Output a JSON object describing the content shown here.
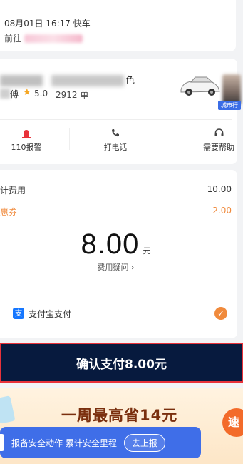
{
  "trip": {
    "time_text": "08月01日 16:17 快车",
    "dest_prefix": "前往"
  },
  "driver": {
    "car_color": "色",
    "name_suffix": "傅",
    "star": "★",
    "rating": "5.0",
    "trips": "2912 单",
    "city_tag": "城市行"
  },
  "actions": [
    {
      "label": "110报警",
      "icon": "alarm-light-icon"
    },
    {
      "label": "打电话",
      "icon": "phone-icon"
    },
    {
      "label": "需要帮助",
      "icon": "headset-icon"
    }
  ],
  "fee": {
    "trip_fee_label": "计费用",
    "trip_fee_value": "10.00",
    "coupon_label": "惠券",
    "coupon_value": "-2.00",
    "total": "8.00",
    "unit": "元",
    "question": "费用疑问 ›",
    "pay_method": "支付宝支付"
  },
  "confirm_label": "确认支付8.00元",
  "promo": {
    "text": "一周最高省14元",
    "badge": "速"
  },
  "safety": {
    "text": "报备安全动作 累计安全里程",
    "button": "去上报"
  },
  "colors": {
    "confirm_bg": "#071a3e",
    "confirm_border": "#e8323a",
    "accent_orange": "#f08a3c",
    "safety_blue": "#3f6ee8"
  }
}
